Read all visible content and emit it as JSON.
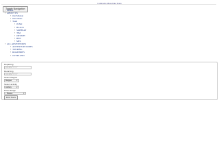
{
  "header": {
    "title_link": "Cambodia Motorbike Tours"
  },
  "nav": {
    "toggle_label": "Toggle Navigation",
    "items": {
      "home": "HOME",
      "about": "ABOUT US",
      "about_children": {
        "our_mission": "Our Mission",
        "our_values": "Our Values",
        "team": "Team"
      },
      "team_members": [
        "JUNO",
        "BLACK",
        "SOPHEAP",
        "TIM",
        "ORYATH",
        "BEN",
        "MEL"
      ],
      "all_adventures": "ALL ADVENTURES",
      "adventure_children": [
        "ADVENTURE RIDES",
        "TOURING",
        "ROADTRIPS",
        "OVERLAND"
      ]
    }
  },
  "form": {
    "departing_label": "Departing",
    "departing_placeholder": "DD/MM/YYYY",
    "returning_label": "Returning",
    "returning_placeholder": "DD/MM/YYYY",
    "select_region_label": "Select Region",
    "region_value": "Mapper",
    "select_activity_label": "Select activity",
    "activity_value": "Activity",
    "price_range_label": "Price Range",
    "price_value": "- Please",
    "submit_label": "Find Tours"
  }
}
